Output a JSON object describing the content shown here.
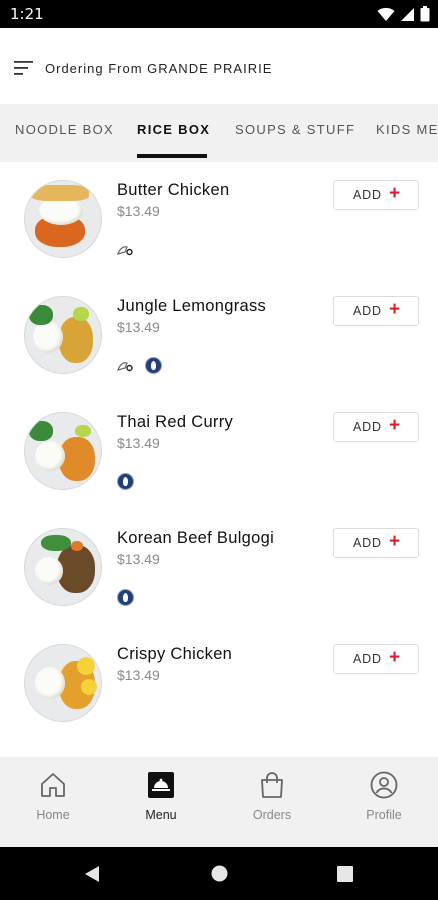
{
  "status": {
    "time": "1:21",
    "icons": [
      "wifi-icon",
      "signal-icon",
      "battery-icon"
    ]
  },
  "header": {
    "title": "Ordering From GRANDE PRAIRIE",
    "menu_icon": "sort-menu-icon"
  },
  "tabs": [
    {
      "label": "NOODLE BOX",
      "active": false
    },
    {
      "label": "RICE BOX",
      "active": true
    },
    {
      "label": "SOUPS & STUFF",
      "active": false
    },
    {
      "label": "KIDS ME",
      "active": false
    }
  ],
  "items": [
    {
      "name": "Butter Chicken",
      "price": "$13.49",
      "add_label": "ADD",
      "tags": [
        "spicy-icon"
      ]
    },
    {
      "name": "Jungle Lemongrass",
      "price": "$13.49",
      "add_label": "ADD",
      "tags": [
        "spicy-icon",
        "vegetarian-badge-icon"
      ]
    },
    {
      "name": "Thai Red Curry",
      "price": "$13.49",
      "add_label": "ADD",
      "tags": [
        "vegetarian-badge-icon"
      ]
    },
    {
      "name": "Korean Beef Bulgogi",
      "price": "$13.49",
      "add_label": "ADD",
      "tags": [
        "vegetarian-badge-icon"
      ]
    },
    {
      "name": "Crispy Chicken",
      "price": "$13.49",
      "add_label": "ADD",
      "tags": []
    }
  ],
  "bottom_nav": [
    {
      "label": "Home",
      "icon": "home-icon",
      "active": false
    },
    {
      "label": "Menu",
      "icon": "menu-icon",
      "active": true
    },
    {
      "label": "Orders",
      "icon": "shopping-bag-icon",
      "active": false
    },
    {
      "label": "Profile",
      "icon": "profile-icon",
      "active": false
    }
  ],
  "colors": {
    "accent": "#d3202a",
    "badge": "#223f7c",
    "tab_bg": "#f1f1f2"
  }
}
